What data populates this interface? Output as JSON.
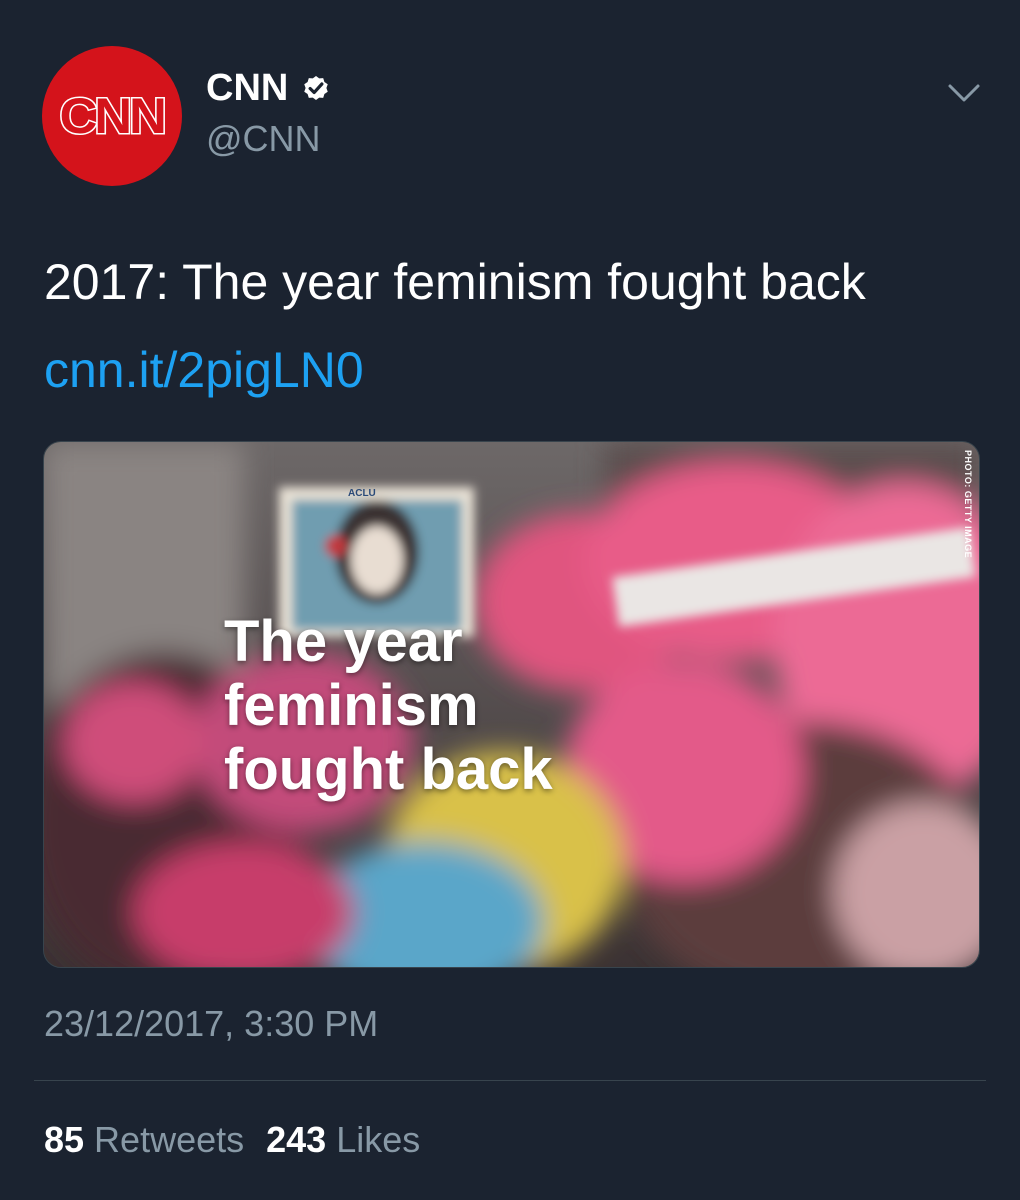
{
  "author": {
    "avatar_logo": "CNN",
    "display_name": "CNN",
    "handle": "@CNN",
    "verified": true,
    "avatar_color": "#d4131b"
  },
  "tweet": {
    "text": "2017: The year feminism fought back",
    "link": "cnn.it/2pigLN0",
    "link_color": "#1da1f2"
  },
  "media": {
    "headline_lines": [
      "The year",
      "feminism",
      "fought back"
    ],
    "sign_label": "ACLU",
    "photo_credit": "PHOTO: GETTY IMAGE"
  },
  "meta": {
    "timestamp": "23/12/2017, 3:30 PM",
    "retweets_count": "85",
    "retweets_label": "Retweets",
    "likes_count": "243",
    "likes_label": "Likes"
  },
  "icons": {
    "verified": "verified-badge-icon",
    "menu": "chevron-down-icon"
  },
  "colors": {
    "background": "#1b2330",
    "secondary_text": "#8899a6",
    "divider": "#38444d"
  }
}
